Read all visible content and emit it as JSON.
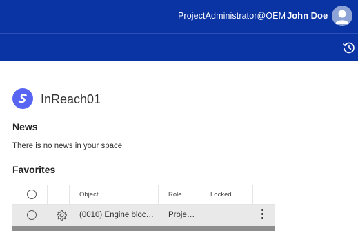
{
  "header": {
    "account": "ProjectAdministrator@OEM",
    "user_name": "John Doe"
  },
  "toolbar": {
    "history_icon": "history-icon"
  },
  "space": {
    "name": "InReach01",
    "logo_icon": "space-logo-icon",
    "logo_color": "#5865f2"
  },
  "news": {
    "title": "News",
    "empty_text": "There is no news in your space"
  },
  "favorites": {
    "title": "Favorites",
    "columns": [
      "Object",
      "Role",
      "Locked"
    ],
    "rows": [
      {
        "icon": "gear-icon",
        "object": "(0010) Engine bloc…",
        "role": "Proje…",
        "locked": ""
      }
    ]
  },
  "colors": {
    "header_bg": "#0a34a3",
    "row_bg": "#e9e9e9"
  }
}
